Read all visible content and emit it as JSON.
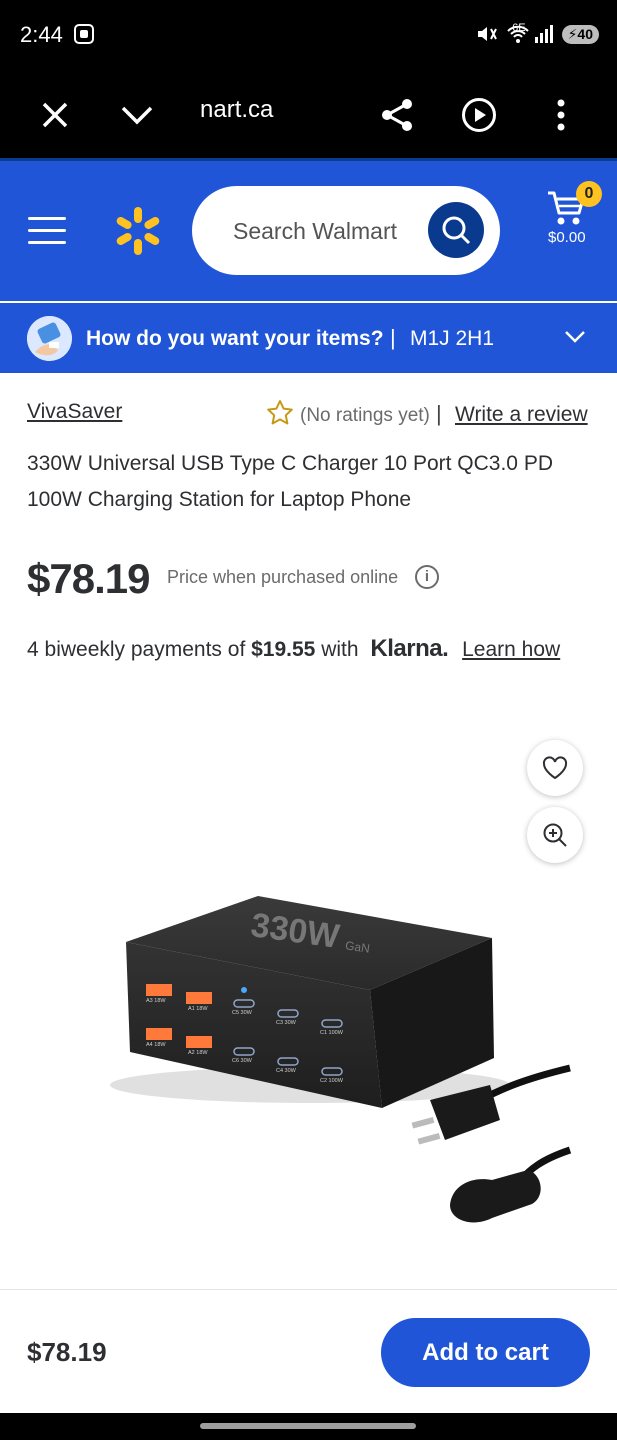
{
  "status_bar": {
    "time": "2:44",
    "network": "6E",
    "battery": "40"
  },
  "browser": {
    "url": "nart.ca"
  },
  "header": {
    "search_placeholder": "Search Walmart",
    "cart_count": "0",
    "cart_total": "$0.00",
    "accent_color": "#1f55d6",
    "spark_color": "#ffc220"
  },
  "delivery": {
    "prompt": "How do you want your items?",
    "separator": "|",
    "postal_code": "M1J 2H1"
  },
  "product": {
    "brand": "VivaSaver",
    "rating_text": "(No ratings yet)",
    "rating_separator": "|",
    "write_review": "Write a review",
    "title": "330W Universal USB Type C Charger 10 Port QC3.0 PD 100W Charging Station for Laptop Phone",
    "price": "$78.19",
    "price_note": "Price when purchased online",
    "info_icon_label": "i",
    "klarna": {
      "prefix": "4 biweekly payments of",
      "amount": "$19.55",
      "with": "with",
      "logo": "Klarna.",
      "link": "Learn how"
    },
    "image": {
      "brand_print": "330W",
      "tech_print": "GaN",
      "port_labels": [
        "A3 18W",
        "A1 18W",
        "C5 30W",
        "C3 30W",
        "C1 100W",
        "A4 18W",
        "A2 18W",
        "C6 30W",
        "C4 30W",
        "C2 100W"
      ]
    }
  },
  "footer": {
    "price": "$78.19",
    "add_to_cart": "Add to cart"
  }
}
